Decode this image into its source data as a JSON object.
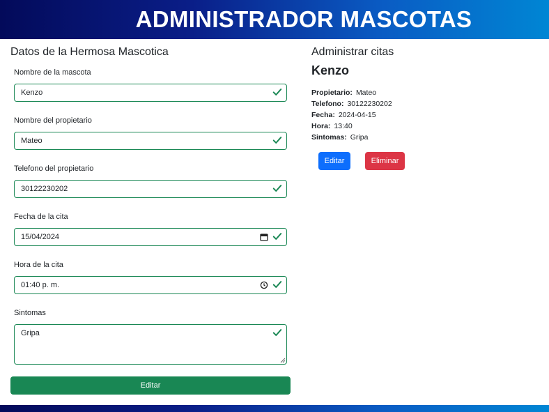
{
  "header": {
    "title": "ADMINISTRADOR MASCOTAS"
  },
  "form": {
    "title": "Datos de la Hermosa Mascotica",
    "fields": [
      {
        "label": "Nombre de la mascota",
        "value": "Kenzo"
      },
      {
        "label": "Nombre del propietario",
        "value": "Mateo"
      },
      {
        "label": "Telefono del propietario",
        "value": "30122230202"
      },
      {
        "label": "Fecha de la cita",
        "value": "15/04/2024"
      },
      {
        "label": "Hora de la cita",
        "value": "01:40 p. m."
      },
      {
        "label": "Sintomas",
        "value": "Gripa"
      }
    ],
    "submit_label": "Editar"
  },
  "appointments": {
    "title": "Administrar citas",
    "items": [
      {
        "pet": "Kenzo",
        "owner_label": "Propietario:",
        "owner": "Mateo",
        "phone_label": "Telefono:",
        "phone": "30122230202",
        "date_label": "Fecha:",
        "date": "2024-04-15",
        "time_label": "Hora:",
        "time": "13:40",
        "symptoms_label": "Sintomas:",
        "symptoms": "Gripa",
        "edit_label": "Editar",
        "delete_label": "Eliminar"
      }
    ]
  },
  "colors": {
    "header_gradient_start": "#030a5a",
    "header_gradient_end": "#0086d4",
    "valid": "#198754",
    "primary": "#0d6efd",
    "danger": "#dc3545"
  }
}
